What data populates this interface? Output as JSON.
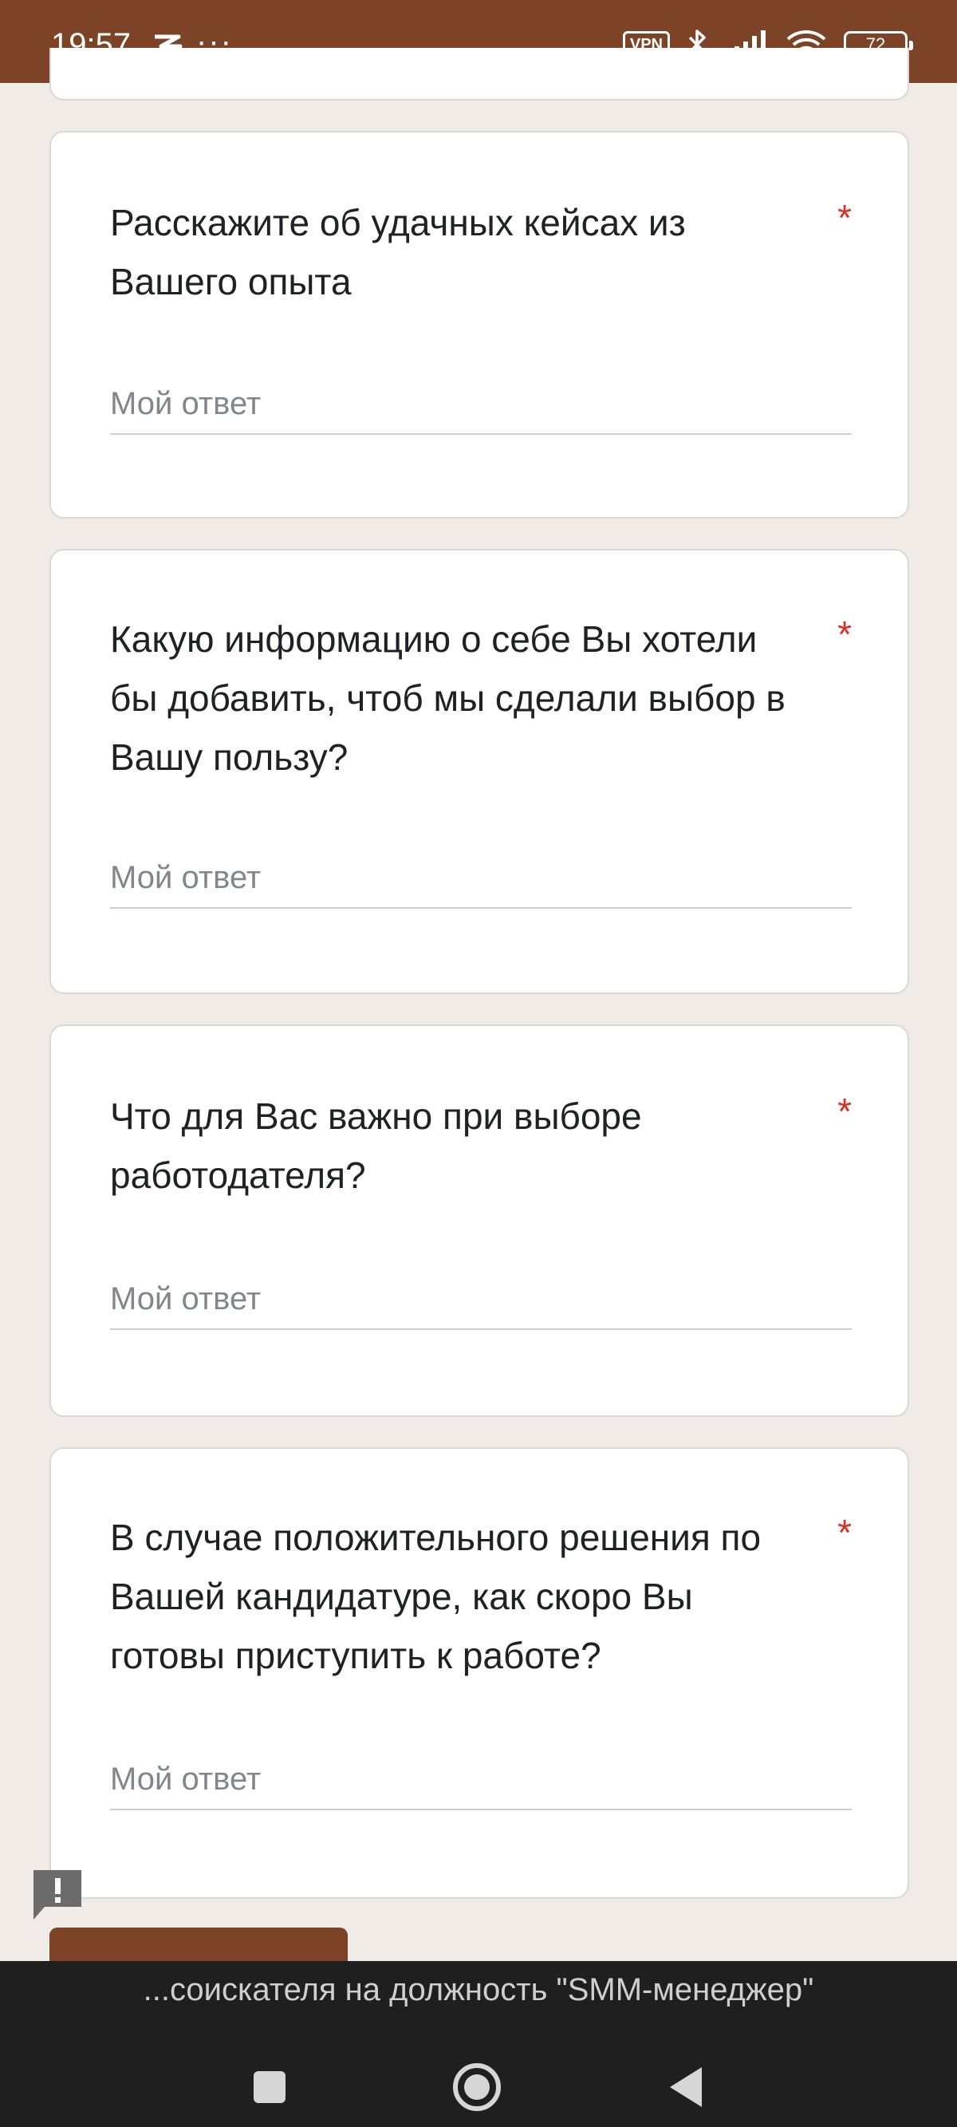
{
  "status_bar": {
    "time": "19:57",
    "more": "···",
    "vpn_label": "VPN",
    "battery_level": "72",
    "icons": [
      "notification-icon",
      "bluetooth-icon",
      "signal-icon",
      "wifi-icon",
      "battery-icon"
    ]
  },
  "questions": [
    {
      "title": "Расскажите об удачных кейсах из Вашего опыта",
      "required_mark": "*",
      "placeholder": "Мой ответ"
    },
    {
      "title": "Какую информацию о себе Вы хотели бы добавить, чтоб мы сделали выбор в Вашу пользу?",
      "required_mark": "*",
      "placeholder": "Мой ответ"
    },
    {
      "title": "Что для Вас важно при выборе работодателя?",
      "required_mark": "*",
      "placeholder": "Мой ответ"
    },
    {
      "title": "В случае положительного решения по Вашей кандидатуре, как скоро Вы готовы приступить к работе?",
      "required_mark": "*",
      "placeholder": "Мой ответ"
    }
  ],
  "nav_bar": {
    "page_title": "...соискателя на должность \"SMM-менеджер\"",
    "buttons": [
      "recents-icon",
      "home-icon",
      "back-icon"
    ]
  },
  "colors": {
    "brand": "#7d4327",
    "background": "#f0ebe7",
    "required": "#d93025"
  }
}
